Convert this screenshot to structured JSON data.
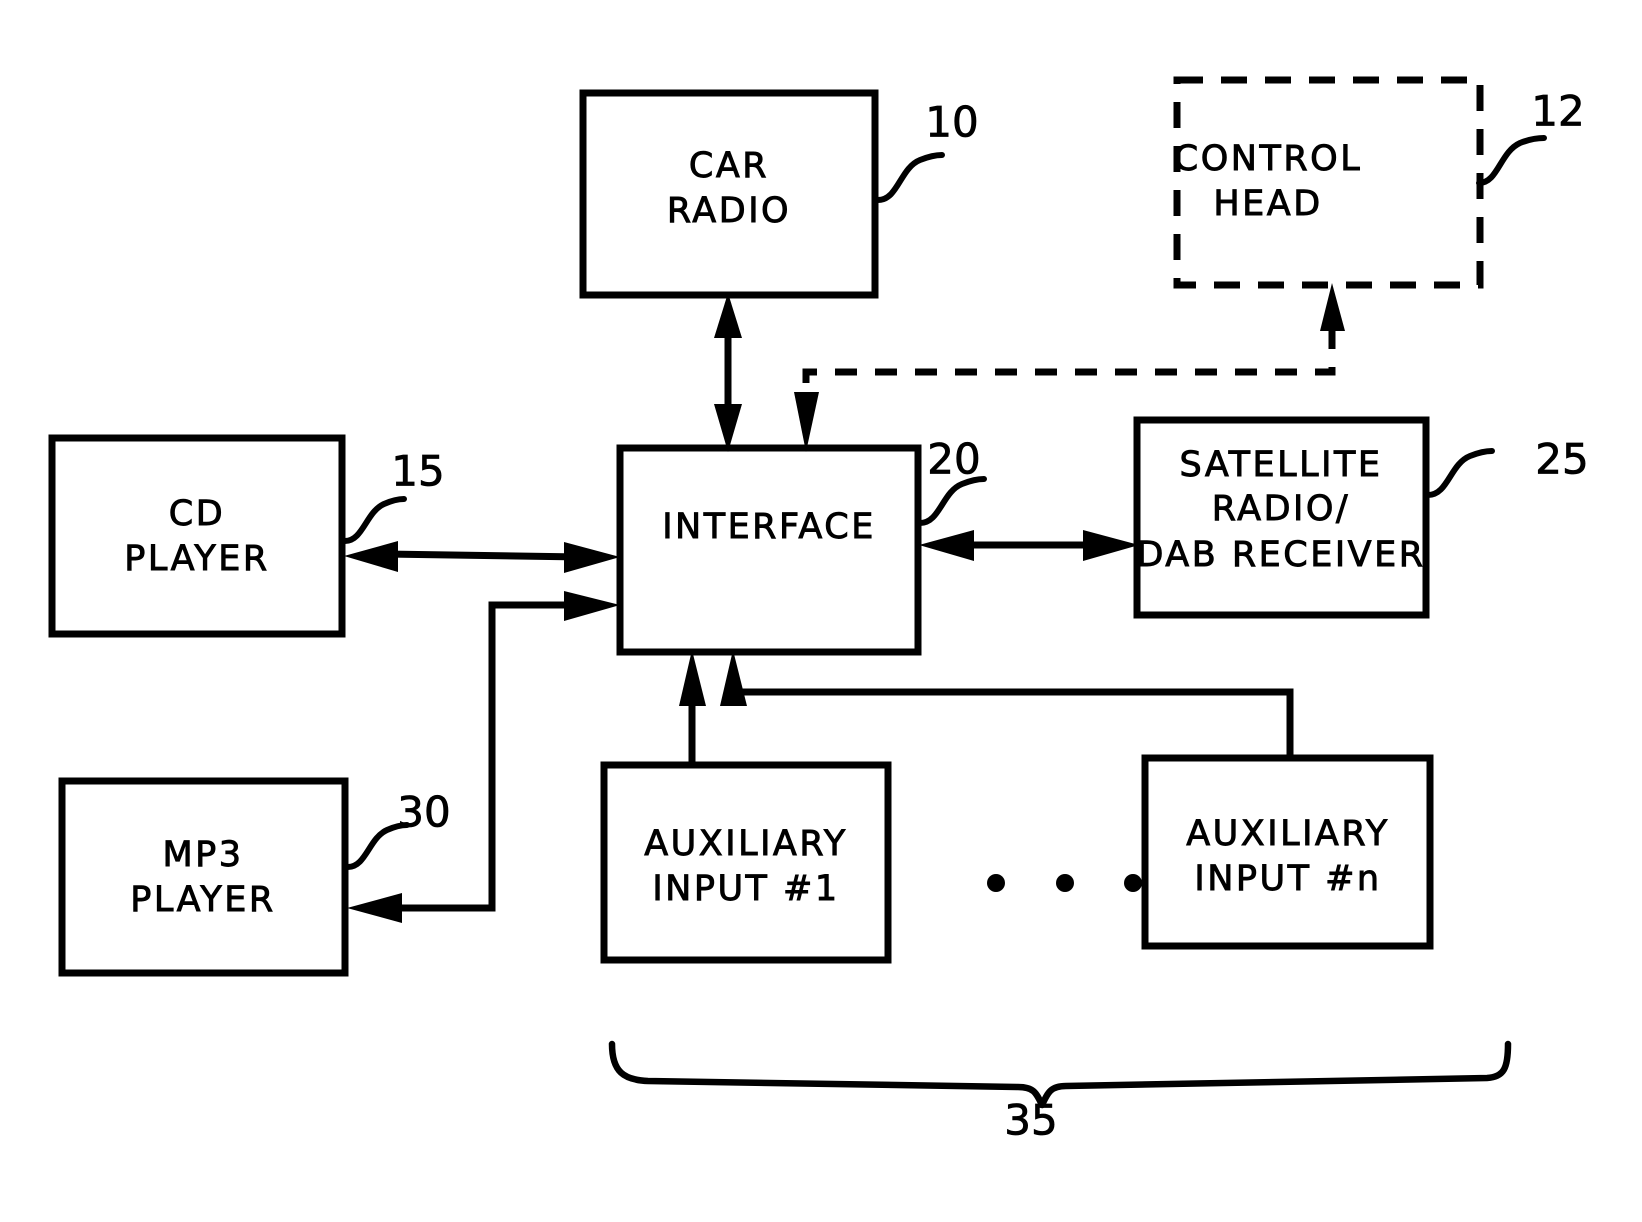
{
  "figure": {
    "type": "patent-block-diagram",
    "background_color": "#ffffff",
    "line_color": "#000000"
  },
  "blocks": {
    "car_radio": {
      "label_line1": "CAR",
      "label_line2": "RADIO",
      "ref": "10",
      "style": "solid"
    },
    "control_head": {
      "label_line1": "CONTROL",
      "label_line2": "HEAD",
      "ref": "12",
      "style": "dashed"
    },
    "cd_player": {
      "label_line1": "CD",
      "label_line2": "PLAYER",
      "ref": "15",
      "style": "solid"
    },
    "interface": {
      "label_line1": "INTERFACE",
      "ref": "20",
      "style": "solid"
    },
    "satellite": {
      "label_line1": "SATELLITE",
      "label_line2": "RADIO/",
      "label_line3": "DAB RECEIVER",
      "ref": "25",
      "style": "solid"
    },
    "mp3_player": {
      "label_line1": "MP3",
      "label_line2": "PLAYER",
      "ref": "30",
      "style": "solid"
    },
    "aux_first": {
      "label_line1": "AUXILIARY",
      "label_line2": "INPUT #1",
      "style": "solid"
    },
    "aux_last": {
      "label_line1": "AUXILIARY",
      "label_line2": "INPUT #n",
      "style": "solid"
    }
  },
  "group_brace": {
    "ref": "35"
  },
  "ellipsis": {
    "glyph": "•",
    "count": 3
  }
}
